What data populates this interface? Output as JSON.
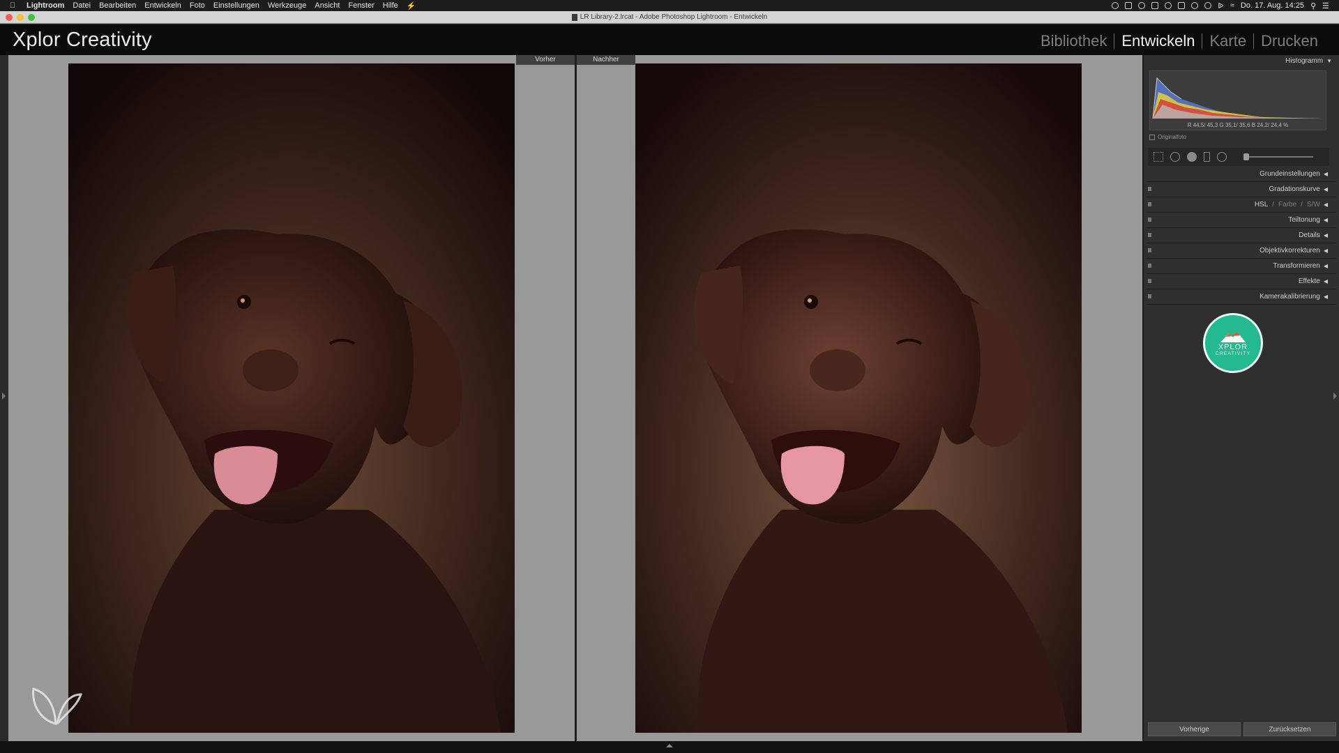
{
  "menubar": {
    "items": [
      "Lightroom",
      "Datei",
      "Bearbeiten",
      "Entwickeln",
      "Foto",
      "Einstellungen",
      "Werkzeuge",
      "Ansicht",
      "Fenster",
      "Hilfe"
    ],
    "clock": "Do. 17. Aug.  14:25"
  },
  "window": {
    "title": "LR Library-2.lrcat - Adobe Photoshop Lightroom - Entwickeln"
  },
  "identity_plate": "Xplor Creativity",
  "modules": [
    {
      "label": "Bibliothek",
      "active": false
    },
    {
      "label": "Entwickeln",
      "active": true
    },
    {
      "label": "Karte",
      "active": false
    },
    {
      "label": "Drucken",
      "active": false
    }
  ],
  "view": {
    "before_label": "Vorher",
    "after_label": "Nachher"
  },
  "panel": {
    "histogram_title": "Histogramm",
    "readout": "R  44,5/ 45,3  G  35,1/ 35,6  B  24,2/ 24,4 %",
    "original_photo": "Originalfoto",
    "sections": [
      {
        "label": "Grundeinstellungen"
      },
      {
        "label": "Gradationskurve"
      },
      {
        "label": "HSL",
        "extra1": "Farbe",
        "extra2": "S/W"
      },
      {
        "label": "Teiltonung"
      },
      {
        "label": "Details"
      },
      {
        "label": "Objektivkorrekturen"
      },
      {
        "label": "Transformieren"
      },
      {
        "label": "Effekte"
      },
      {
        "label": "Kamerakalibrierung"
      }
    ],
    "badge_title": "XPLOR",
    "badge_sub": "CREATIVITY",
    "prev_button": "Vorherige",
    "reset_button": "Zurücksetzen"
  },
  "colors": {
    "accent_badge": "#24b98f",
    "background": "#999999",
    "panel": "#2f2f2f"
  }
}
